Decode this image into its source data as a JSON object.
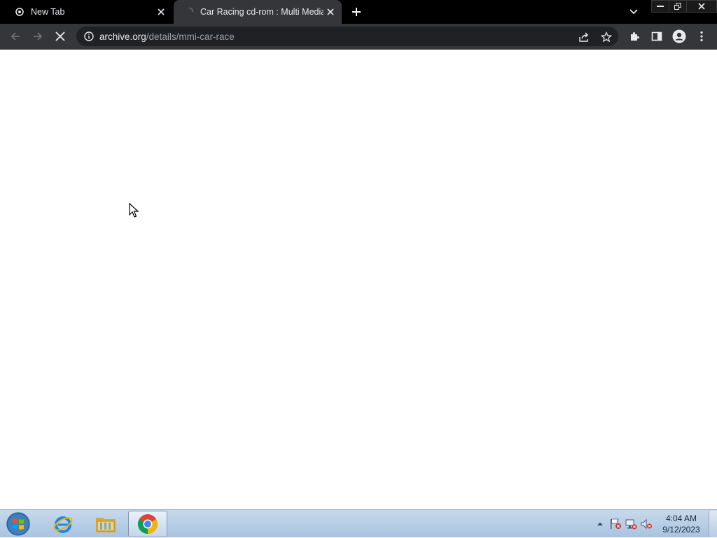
{
  "browser": {
    "tabs": [
      {
        "title": "New Tab",
        "favicon": "chrome-newtab-icon",
        "active": false
      },
      {
        "title": "Car Racing cd-rom : Multi Media",
        "favicon": "loading-icon",
        "active": true
      }
    ],
    "url_host": "archive.org",
    "url_path": "/details/mmi-car-race",
    "theme": {
      "tab_strip": "#000000",
      "toolbar": "#35363a",
      "omnibox": "#202124",
      "text": "#e8eaed"
    }
  },
  "taskbar": {
    "apps": [
      {
        "name": "internet-explorer-icon"
      },
      {
        "name": "file-explorer-icon"
      },
      {
        "name": "chrome-icon",
        "active": true
      }
    ],
    "clock": {
      "time": "4:04 AM",
      "date": "9/12/2023"
    }
  }
}
